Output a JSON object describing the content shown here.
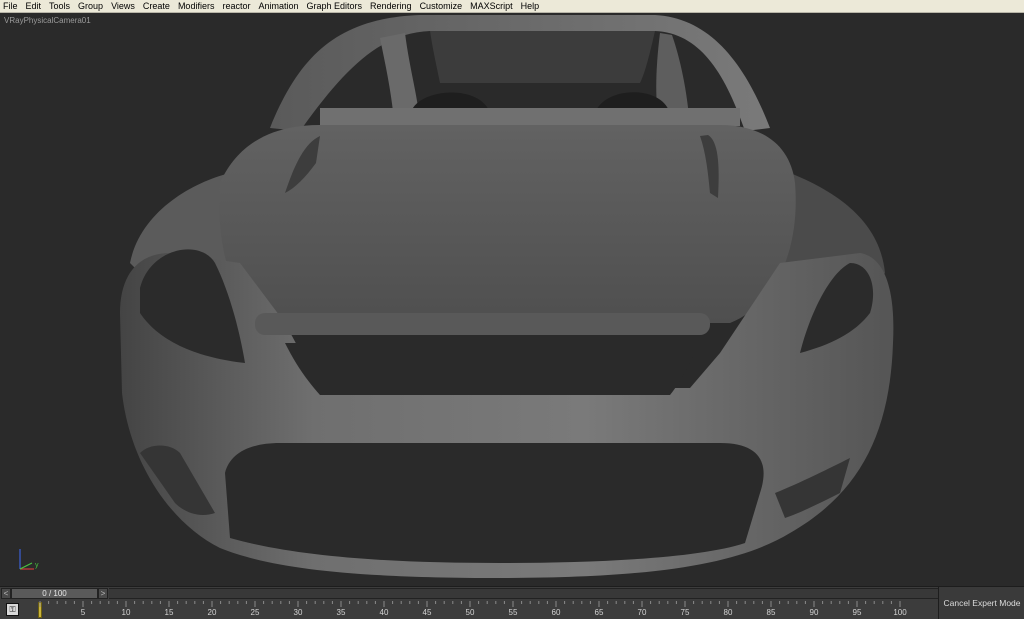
{
  "menu": {
    "items": [
      "File",
      "Edit",
      "Tools",
      "Group",
      "Views",
      "Create",
      "Modifiers",
      "reactor",
      "Animation",
      "Graph Editors",
      "Rendering",
      "Customize",
      "MAXScript",
      "Help"
    ]
  },
  "viewport": {
    "label": "VRayPhysicalCamera01",
    "axis": {
      "x": "x",
      "y": "y"
    }
  },
  "timeline": {
    "slider_value": "0 / 100",
    "left_arrow": "<",
    "right_arrow": ">",
    "key_icon": "key-icon",
    "current_frame": 0,
    "total_frames": 100,
    "tick_labels": [
      "0",
      "5",
      "10",
      "15",
      "20",
      "25",
      "30",
      "35",
      "40",
      "45",
      "50",
      "55",
      "60",
      "65",
      "70",
      "75",
      "80",
      "85",
      "90",
      "95",
      "100"
    ]
  },
  "status": {
    "cancel_expert_label": "Cancel Expert Mode"
  },
  "colors": {
    "menubar": "#ece9d8",
    "viewport_bg": "#2a2a2a",
    "model_shade": "#6b6b6b",
    "frame_marker": "#c9b43a",
    "axis_x": "#cf3b3b",
    "axis_y": "#49c23f",
    "axis_z": "#3b61d6"
  }
}
